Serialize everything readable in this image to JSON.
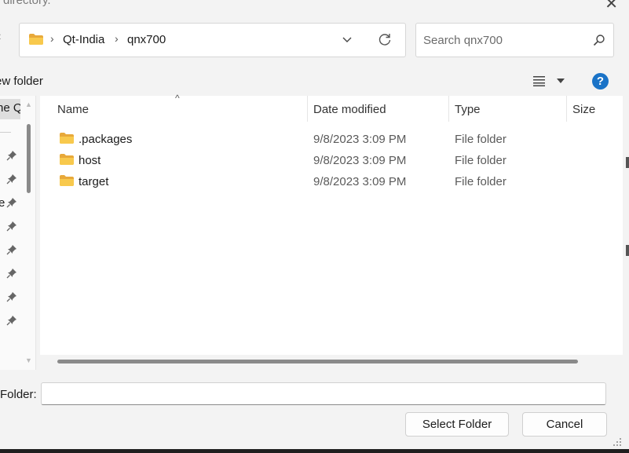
{
  "window": {
    "title": "directory."
  },
  "address": {
    "crumbs": [
      "Qt-India",
      "qnx700"
    ],
    "separator": "›"
  },
  "search": {
    "placeholder": "Search qnx700"
  },
  "toolbar": {
    "new_folder_label": "ew folder"
  },
  "nav": {
    "top_item_label": "ne Q",
    "partial_label": "e",
    "pinned_count": 8
  },
  "columns": [
    "Name",
    "Date modified",
    "Type",
    "Size"
  ],
  "files": [
    {
      "name": ".packages",
      "date": "9/8/2023 3:09 PM",
      "type": "File folder"
    },
    {
      "name": "host",
      "date": "9/8/2023 3:09 PM",
      "type": "File folder"
    },
    {
      "name": "target",
      "date": "9/8/2023 3:09 PM",
      "type": "File folder"
    }
  ],
  "footer": {
    "folder_label": "Folder:",
    "folder_value": "",
    "select_button": "Select Folder",
    "cancel_button": "Cancel"
  },
  "colors": {
    "accent": "#1a73c7",
    "folder": "#f4c44e"
  }
}
